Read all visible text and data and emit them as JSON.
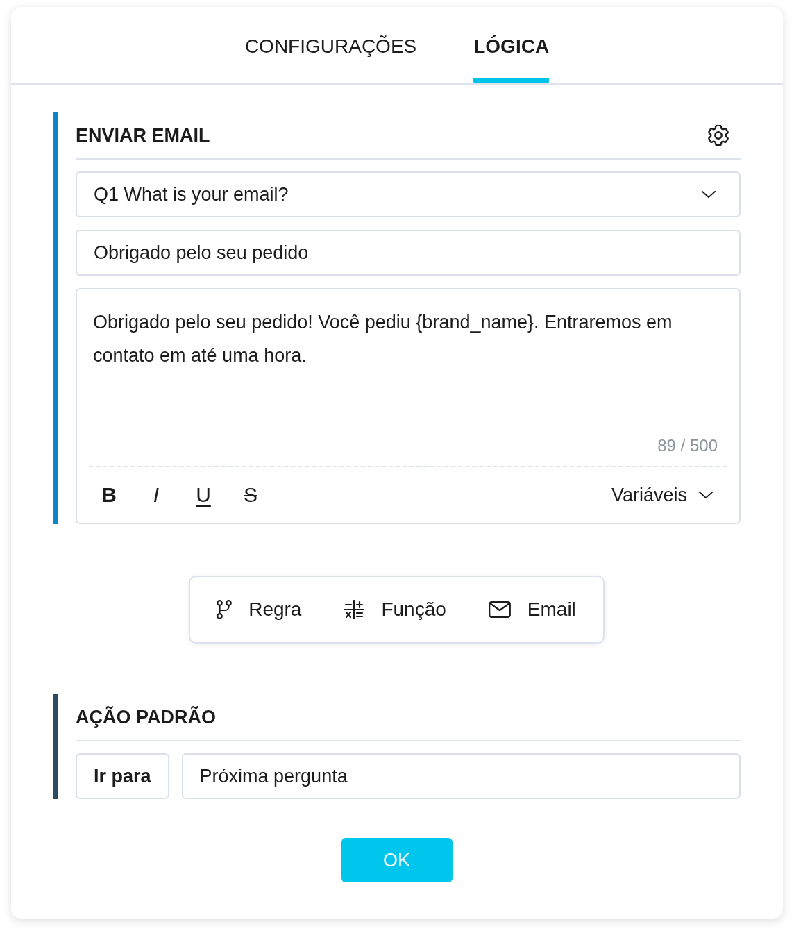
{
  "tabs": [
    {
      "label": "CONFIGURAÇÕES",
      "selected": false
    },
    {
      "label": "LÓGICA",
      "selected": true
    }
  ],
  "send_email": {
    "title": "ENVIAR EMAIL",
    "question_select": {
      "value": "Q1 What is your email?"
    },
    "subject_field": {
      "value": "Obrigado pelo seu pedido"
    },
    "message_editor": {
      "value": "Obrigado pelo seu pedido! Você pediu {brand_name}. Entraremos em contato em até uma hora.",
      "counter": "89 / 500",
      "format_buttons": [
        {
          "label": "B",
          "kind": "bold"
        },
        {
          "label": "I",
          "kind": "italic"
        },
        {
          "label": "U",
          "kind": "underline"
        },
        {
          "label": "S",
          "kind": "strikethrough"
        }
      ],
      "variables_menu": "Variáveis"
    }
  },
  "add_actions": [
    {
      "label": "Regra",
      "kind": "rule"
    },
    {
      "label": "Função",
      "kind": "function"
    },
    {
      "label": "Email",
      "kind": "email"
    }
  ],
  "default_action": {
    "title": "AÇÃO PADRÃO",
    "label": "Ir para",
    "value": "Próxima pergunta"
  },
  "ok_button": "OK"
}
